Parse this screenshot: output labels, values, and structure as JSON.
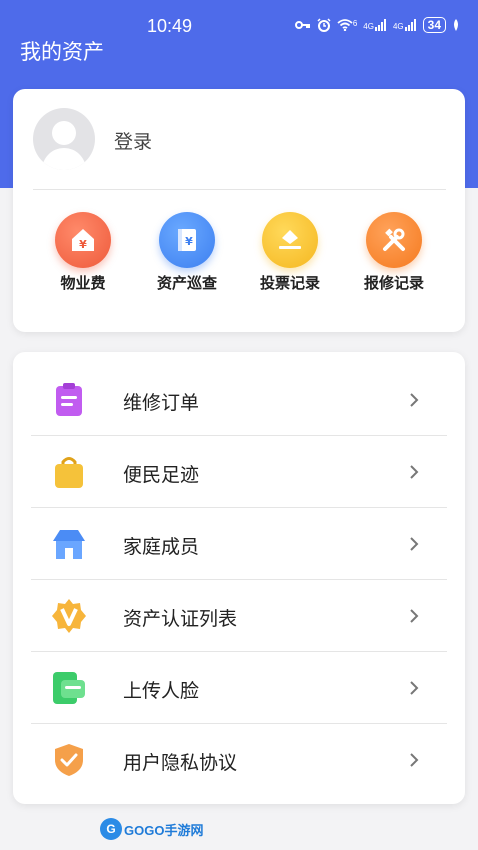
{
  "status_bar": {
    "time": "10:49",
    "battery": "34",
    "signal_1": "4G",
    "signal_2": "4G",
    "wifi_badge": "6"
  },
  "header": {
    "title": "我的资产"
  },
  "profile": {
    "login_label": "登录"
  },
  "quick_actions": [
    {
      "label": "物业费",
      "icon": "house-yen-icon",
      "color": "#ee5a3b"
    },
    {
      "label": "资产巡查",
      "icon": "ledger-yen-icon",
      "color": "#3d7ff0"
    },
    {
      "label": "投票记录",
      "icon": "ballot-box-icon",
      "color": "#f5b720"
    },
    {
      "label": "报修记录",
      "icon": "tools-icon",
      "color": "#f57a1f"
    }
  ],
  "menu": [
    {
      "label": "维修订单",
      "icon": "clipboard-icon",
      "color": "#c15cf0"
    },
    {
      "label": "便民足迹",
      "icon": "shopping-bag-icon",
      "color": "#f5c23a"
    },
    {
      "label": "家庭成员",
      "icon": "home-icon",
      "color": "#4b8cf5"
    },
    {
      "label": "资产认证列表",
      "icon": "badge-v-icon",
      "color": "#f7b53b"
    },
    {
      "label": "上传人脸",
      "icon": "wallet-card-icon",
      "color": "#3ccc6a"
    },
    {
      "label": "用户隐私协议",
      "icon": "shield-check-icon",
      "color": "#f5a04a"
    }
  ],
  "watermark": {
    "brand": "GOGO手游网",
    "badge": "G"
  },
  "colors": {
    "header_bg": "#4e6bea",
    "page_bg": "#f3f3f5"
  }
}
